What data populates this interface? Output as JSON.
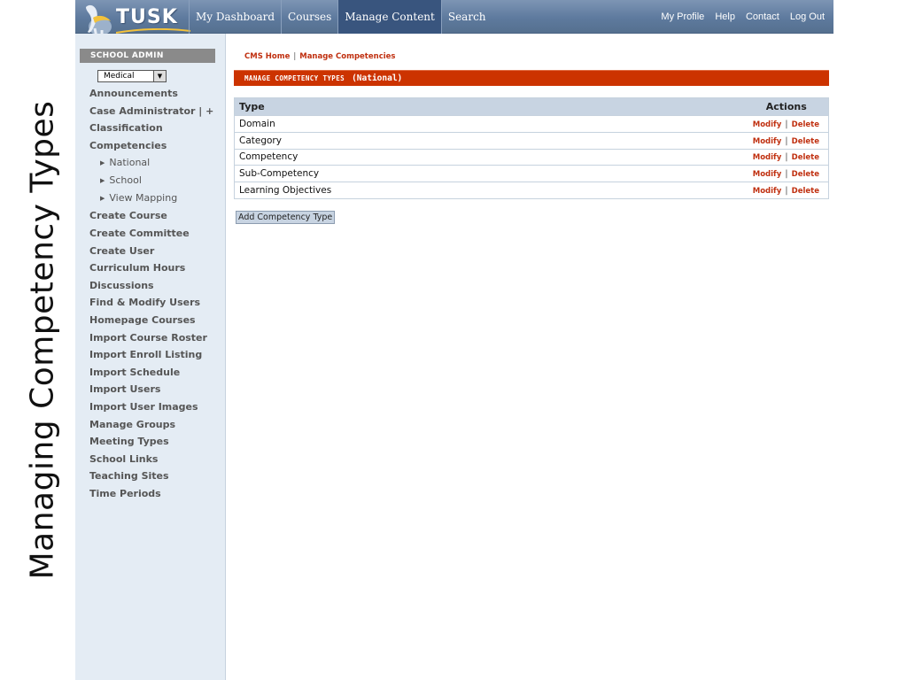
{
  "caption": "Managing Competency Types",
  "topnav": {
    "logo": "TUSK",
    "items": [
      "My Dashboard",
      "Courses",
      "Manage Content",
      "Search"
    ],
    "active_index": 2,
    "right_items": [
      "My Profile",
      "Help",
      "Contact",
      "Log Out"
    ]
  },
  "sidebar": {
    "heading": "SCHOOL ADMIN",
    "school_select": "Medical",
    "links_top": [
      "Announcements",
      "Case Administrator | +",
      "Classification",
      "Competencies"
    ],
    "sub_links": [
      "National",
      "School",
      "View Mapping"
    ],
    "links_bottom": [
      "Create Course",
      "Create Committee",
      "Create User",
      "Curriculum Hours",
      "Discussions",
      "Find & Modify Users",
      "Homepage Courses",
      "Import Course Roster",
      "Import Enroll Listing",
      "Import Schedule",
      "Import Users",
      "Import User Images",
      "Manage Groups",
      "Meeting Types",
      "School Links",
      "Teaching Sites",
      "Time Periods"
    ]
  },
  "main": {
    "breadcrumb": [
      "CMS Home",
      "Manage Competencies"
    ],
    "breadcrumb_sep": "|",
    "title": "MANAGE COMPETENCY TYPES",
    "title_scope": "(National)",
    "table": {
      "col_type": "Type",
      "col_actions": "Actions",
      "rows": [
        "Domain",
        "Category",
        "Competency",
        "Sub-Competency",
        "Learning Objectives"
      ],
      "modify_label": "Modify",
      "delete_label": "Delete",
      "action_sep": "|"
    },
    "add_button": "Add Competency Type"
  },
  "colors": {
    "nav_bg": "#5e7a9e",
    "nav_active": "#39557e",
    "sidebar_bg": "#e4ecf4",
    "title_bar": "#cc3300",
    "link_red": "#c03010",
    "table_header": "#c8d4e2"
  }
}
